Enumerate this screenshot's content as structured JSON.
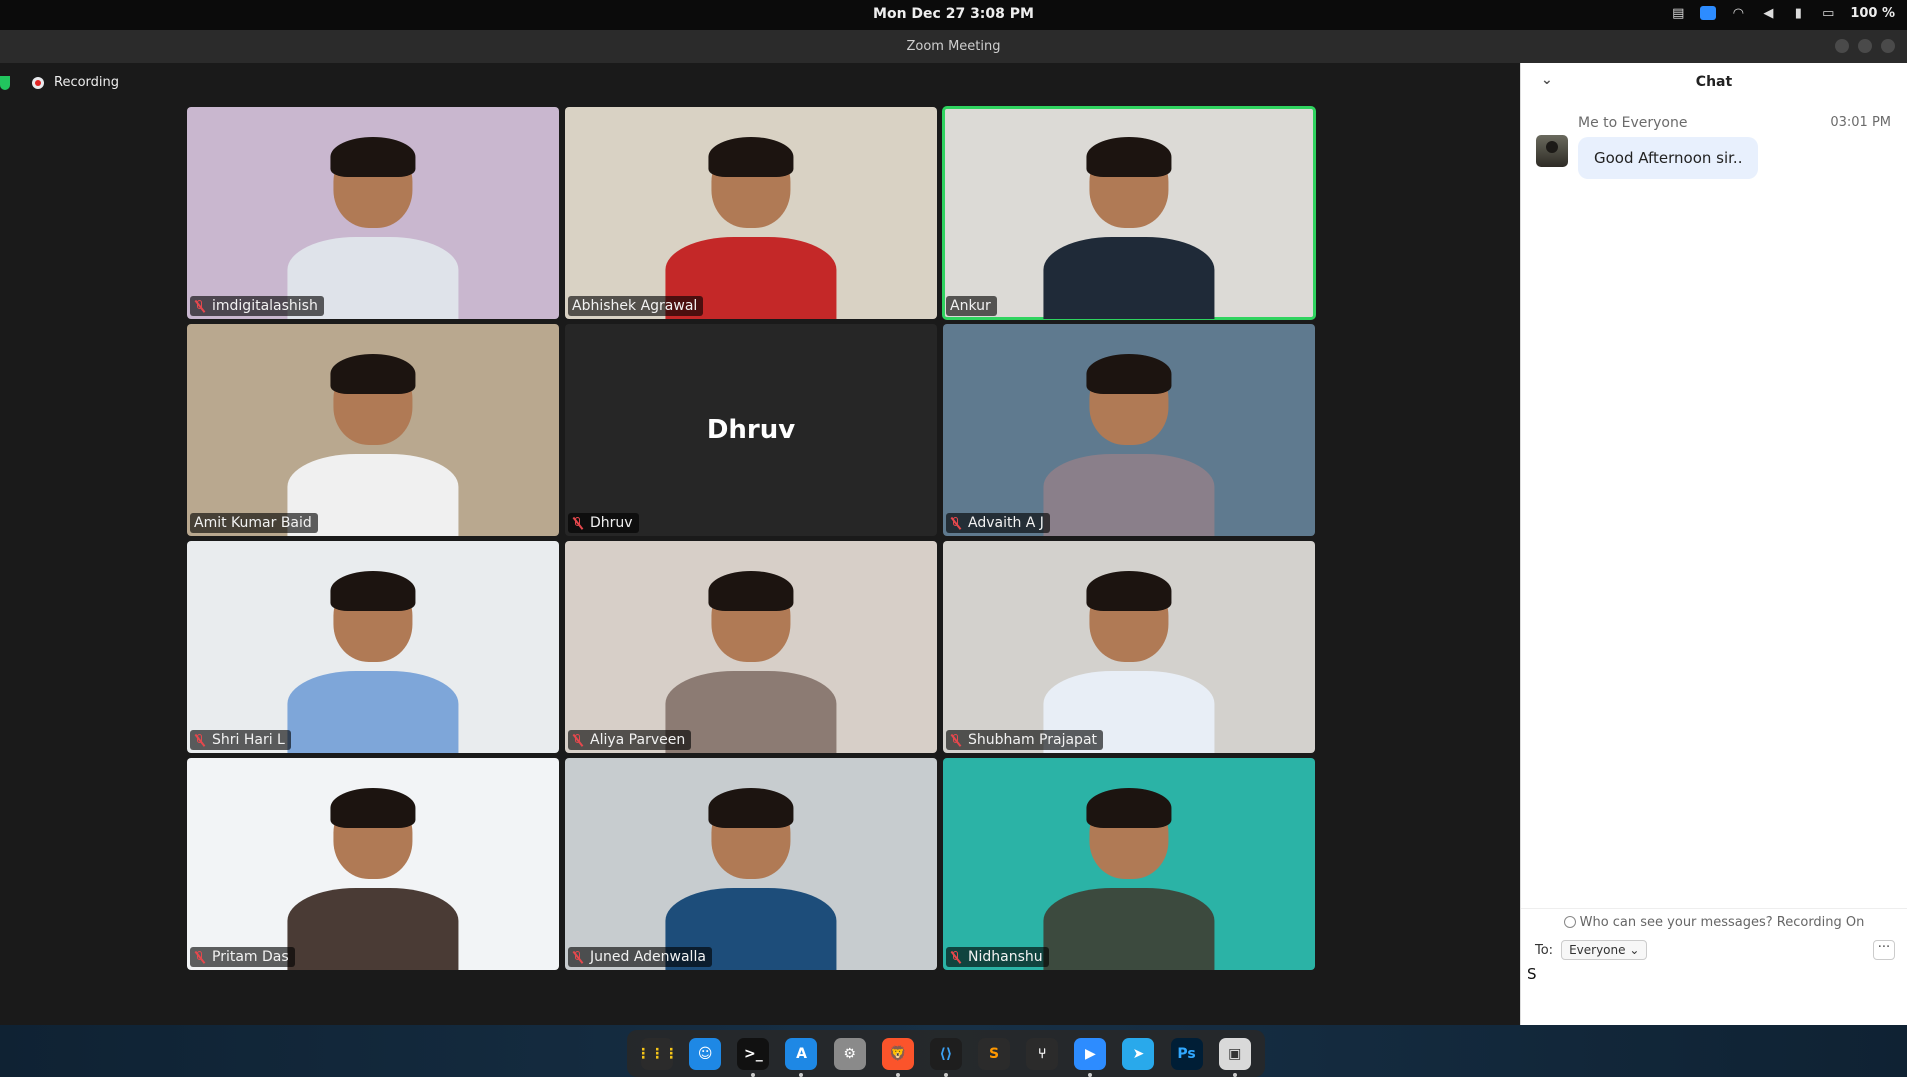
{
  "system_bar": {
    "clock": "Mon Dec 27   3:08 PM",
    "battery": "100 %"
  },
  "window": {
    "title": "Zoom Meeting"
  },
  "meeting": {
    "recording_label": "Recording",
    "participants": [
      {
        "name": "imdigitalashish",
        "muted": true,
        "bg": "#c9b7cf",
        "shirt": "#dfe3ea"
      },
      {
        "name": "Abhishek Agrawal",
        "muted": false,
        "bg": "#d9d2c4",
        "shirt": "#c42828"
      },
      {
        "name": "Ankur",
        "muted": false,
        "bg": "#dcdad6",
        "shirt": "#1f2a38",
        "speaking": true
      },
      {
        "name": "Amit Kumar Baid",
        "muted": false,
        "bg": "#b9a88f",
        "shirt": "#f0f0f0"
      },
      {
        "name": "Dhruv",
        "muted": true,
        "bg": "#262626",
        "video_off": true,
        "placeholder": "Dhruv"
      },
      {
        "name": "Advaith A J",
        "muted": true,
        "bg": "#5f7a8f",
        "shirt": "#8a7f8a"
      },
      {
        "name": "Shri Hari L",
        "muted": true,
        "bg": "#e9ecee",
        "shirt": "#7ea6d9"
      },
      {
        "name": "Aliya Parveen",
        "muted": true,
        "bg": "#d7cfc8",
        "shirt": "#8c7b73"
      },
      {
        "name": "Shubham Prajapat",
        "muted": true,
        "bg": "#d3d1cd",
        "shirt": "#e8eef6"
      },
      {
        "name": "Pritam Das",
        "muted": true,
        "bg": "#f2f4f6",
        "shirt": "#4a3b35"
      },
      {
        "name": "Juned Adenwalla",
        "muted": true,
        "bg": "#c7cccf",
        "shirt": "#1d4d7a"
      },
      {
        "name": "Nidhanshu",
        "muted": true,
        "bg": "#2bb3a6",
        "shirt": "#3c4a3e"
      }
    ]
  },
  "chat": {
    "title": "Chat",
    "messages": [
      {
        "from": "Me to Everyone",
        "time": "03:01 PM",
        "text": "Good Afternoon sir.."
      }
    ],
    "privacy_note": "Who can see your messages? Recording On",
    "to_label": "To:",
    "recipient": "Everyone",
    "compose_text": "S"
  },
  "dock": {
    "apps": [
      {
        "name": "app-grid",
        "glyph": "⋮⋮⋮",
        "color": "#2b2b2b",
        "text_color": "#f5c518",
        "running": false
      },
      {
        "name": "finder",
        "glyph": "☺",
        "color": "#1e88e5",
        "running": false
      },
      {
        "name": "terminal",
        "glyph": ">_",
        "color": "#111111",
        "running": true
      },
      {
        "name": "app-store",
        "glyph": "A",
        "color": "#1e88e5",
        "running": true
      },
      {
        "name": "settings",
        "glyph": "⚙",
        "color": "#8a8a8a",
        "running": false
      },
      {
        "name": "brave",
        "glyph": "🦁",
        "color": "#fb542b",
        "running": true
      },
      {
        "name": "vscode",
        "glyph": "⟨⟩",
        "color": "#1e1e1e",
        "text_color": "#3ba0f2",
        "running": true
      },
      {
        "name": "sublime",
        "glyph": "S",
        "color": "#2b2b2b",
        "text_color": "#ff9800",
        "running": false
      },
      {
        "name": "git-fork",
        "glyph": "⑂",
        "color": "#2b2b2b",
        "running": false
      },
      {
        "name": "zoom",
        "glyph": "▶",
        "color": "#2d8cff",
        "running": true
      },
      {
        "name": "telegram",
        "glyph": "➤",
        "color": "#29a9eb",
        "running": false
      },
      {
        "name": "photoshop",
        "glyph": "Ps",
        "color": "#001e36",
        "text_color": "#31a8ff",
        "running": false
      },
      {
        "name": "screenshot",
        "glyph": "▣",
        "color": "#d9d9d9",
        "text_color": "#333333",
        "running": true
      }
    ]
  }
}
